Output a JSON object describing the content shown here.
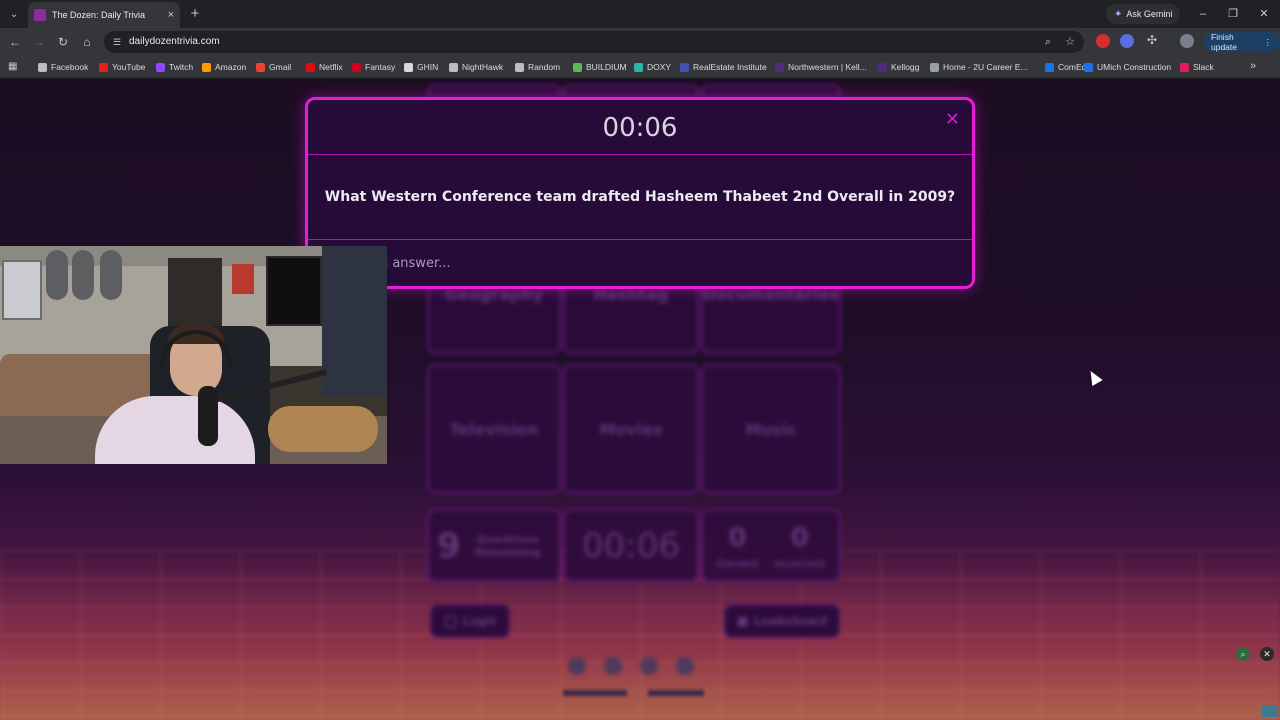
{
  "browser": {
    "tab": {
      "title": "The Dozen: Daily Trivia",
      "close": "×"
    },
    "new_tab": "+",
    "ask_gemini": "Ask Gemini",
    "url": "dailydozentrivia.com",
    "finish_update": "Finish update",
    "window_controls": {
      "minimize": "–",
      "restore": "❐",
      "close": "✕"
    },
    "bookmarks": [
      {
        "label": "Facebook",
        "color": "#bdbdbd"
      },
      {
        "label": "YouTube",
        "color": "#e62117"
      },
      {
        "label": "Twitch",
        "color": "#9146ff"
      },
      {
        "label": "Amazon",
        "color": "#ff9900"
      },
      {
        "label": "Gmail",
        "color": "#ea4335"
      },
      {
        "label": "Netflix",
        "color": "#e50914"
      },
      {
        "label": "Fantasy",
        "color": "#d0021b"
      },
      {
        "label": "GHIN",
        "color": "#d8d8d8"
      },
      {
        "label": "NightHawk",
        "color": "#bdbdbd"
      },
      {
        "label": "Random",
        "color": "#bdbdbd"
      },
      {
        "label": "BUILDIUM",
        "color": "#5cb85c"
      },
      {
        "label": "DOXY",
        "color": "#2bb3a3"
      },
      {
        "label": "RealEstate Institute",
        "color": "#3f51b5"
      },
      {
        "label": "Northwestern | Kell...",
        "color": "#4e2a84"
      },
      {
        "label": "Kellogg",
        "color": "#4e2a84"
      },
      {
        "label": "Home - 2U Career E...",
        "color": "#9aa0a6"
      },
      {
        "label": "ComEd",
        "color": "#1a73e8"
      },
      {
        "label": "UMich Construction",
        "color": "#1a73e8"
      },
      {
        "label": "Slack",
        "color": "#e01e5a"
      }
    ]
  },
  "modal": {
    "timer": "00:06",
    "close": "✕",
    "question": "What Western Conference team drafted Hasheem Thabeet 2nd Overall in 2009?",
    "answer_placeholder": "Type an answer..."
  },
  "background": {
    "categories": [
      "Geography",
      "Hashtag",
      "Documentaries",
      "Television",
      "Movies",
      "Music"
    ],
    "questions_remaining": {
      "count": "9",
      "label": "Questions Remaining"
    },
    "timer": "00:06",
    "correct": {
      "count": "0",
      "label": "Correct"
    },
    "incorrect": {
      "count": "0",
      "label": "Incorrect"
    },
    "login_label": "Login",
    "leaderboard_label": "Leaderboard"
  },
  "colors": {
    "modal_border": "#e71cd9",
    "modal_bg": "#260a38",
    "page_bg": "#1c0d22"
  }
}
